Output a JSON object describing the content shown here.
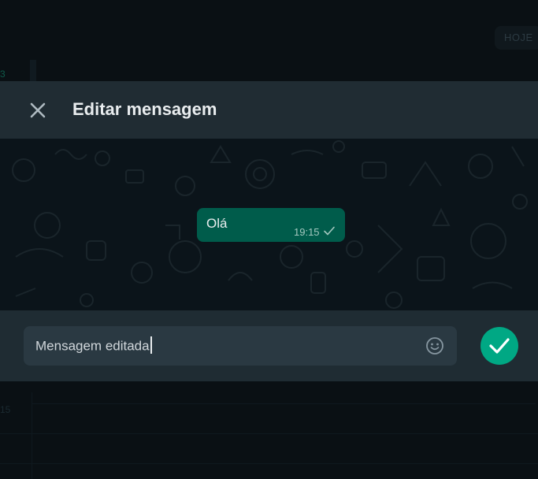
{
  "background": {
    "date_chip": "HOJE",
    "fragment_top": "3",
    "fragment_bottom": "15"
  },
  "modal": {
    "title": "Editar mensagem",
    "close_icon": "close-icon"
  },
  "message": {
    "text": "Olá",
    "time": "19:15",
    "status_icon": "single-check-icon"
  },
  "composer": {
    "value": "Mensagem editada",
    "emoji_icon": "emoji-icon",
    "confirm_icon": "checkmark-icon"
  },
  "colors": {
    "accent": "#00a884",
    "bubble_outgoing": "#005c4b",
    "header_bg": "#202c33",
    "input_bg": "#2a3942"
  }
}
